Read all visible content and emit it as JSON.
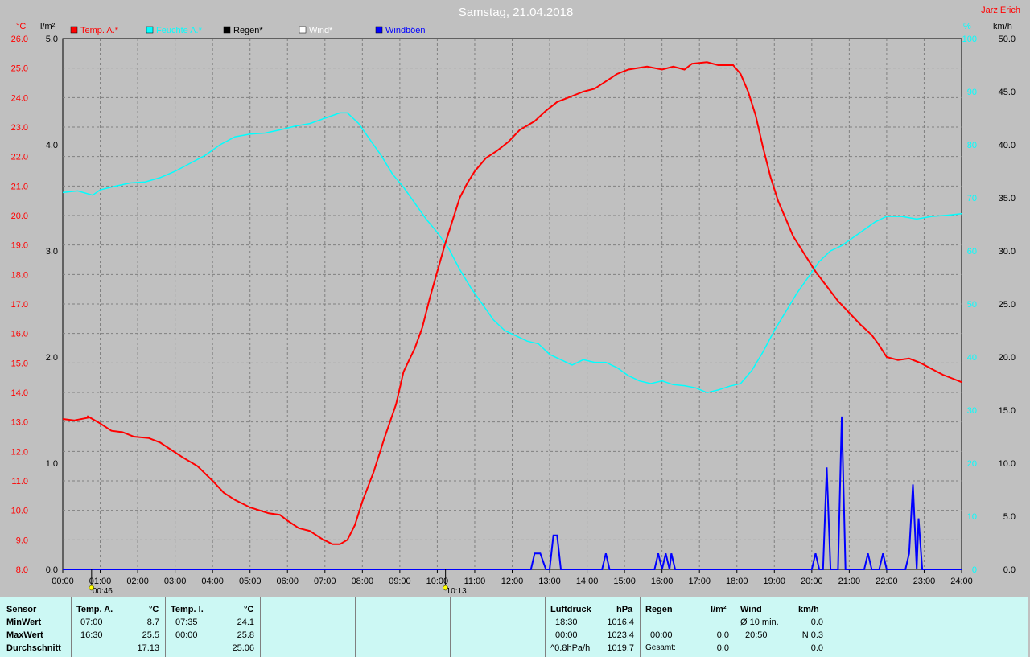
{
  "chart_data": {
    "type": "line",
    "title": "Samstag, 21.04.2018",
    "station": "Jarz Erich",
    "legend": [
      {
        "label": "Temp. A.*",
        "color": "#ff0000"
      },
      {
        "label": "Feuchte A.*",
        "color": "#00ffff"
      },
      {
        "label": "Regen*",
        "color": "#000000"
      },
      {
        "label": "Wind*",
        "color": "#ffffff"
      },
      {
        "label": "Windböen",
        "color": "#0000ff"
      }
    ],
    "axes": {
      "temp": {
        "unit": "°C",
        "min": 8.0,
        "max": 26.0,
        "step": 1.0
      },
      "rain": {
        "unit": "l/m²",
        "min": 0.0,
        "max": 5.0,
        "step": 1.0
      },
      "hum": {
        "unit": "%",
        "min": 0,
        "max": 100,
        "step": 10
      },
      "wind": {
        "unit": "km/h",
        "min": 0.0,
        "max": 50.0,
        "step": 5.0
      }
    },
    "x_ticks": [
      "00:00",
      "01:00",
      "02:00",
      "03:00",
      "04:00",
      "05:00",
      "06:00",
      "07:00",
      "08:00",
      "09:00",
      "10:00",
      "11:00",
      "12:00",
      "13:00",
      "14:00",
      "15:00",
      "16:00",
      "17:00",
      "18:00",
      "19:00",
      "20:00",
      "21:00",
      "22:00",
      "23:00",
      "24:00"
    ],
    "sun_marks": [
      {
        "hour": 0.77,
        "label": "00:46"
      },
      {
        "hour": 10.22,
        "label": "10:13"
      }
    ],
    "temp_series": [
      [
        0,
        13.1
      ],
      [
        0.3,
        13.05
      ],
      [
        0.7,
        13.15
      ],
      [
        0.65,
        13.2
      ],
      [
        1.0,
        12.95
      ],
      [
        1.3,
        12.7
      ],
      [
        1.6,
        12.65
      ],
      [
        1.9,
        12.5
      ],
      [
        2.3,
        12.45
      ],
      [
        2.6,
        12.3
      ],
      [
        2.9,
        12.05
      ],
      [
        3.2,
        11.8
      ],
      [
        3.6,
        11.5
      ],
      [
        4.0,
        11.0
      ],
      [
        4.3,
        10.6
      ],
      [
        4.6,
        10.35
      ],
      [
        5.0,
        10.1
      ],
      [
        5.5,
        9.9
      ],
      [
        5.8,
        9.85
      ],
      [
        6.0,
        9.65
      ],
      [
        6.3,
        9.4
      ],
      [
        6.6,
        9.3
      ],
      [
        6.9,
        9.05
      ],
      [
        7.2,
        8.85
      ],
      [
        7.4,
        8.85
      ],
      [
        7.6,
        9.0
      ],
      [
        7.8,
        9.5
      ],
      [
        8.0,
        10.3
      ],
      [
        8.3,
        11.3
      ],
      [
        8.6,
        12.5
      ],
      [
        8.9,
        13.6
      ],
      [
        9.1,
        14.7
      ],
      [
        9.4,
        15.5
      ],
      [
        9.6,
        16.2
      ],
      [
        9.8,
        17.2
      ],
      [
        10.0,
        18.1
      ],
      [
        10.2,
        19.0
      ],
      [
        10.4,
        19.8
      ],
      [
        10.6,
        20.6
      ],
      [
        10.8,
        21.1
      ],
      [
        11.0,
        21.5
      ],
      [
        11.3,
        21.95
      ],
      [
        11.6,
        22.2
      ],
      [
        11.9,
        22.5
      ],
      [
        12.2,
        22.9
      ],
      [
        12.6,
        23.2
      ],
      [
        12.9,
        23.55
      ],
      [
        13.2,
        23.85
      ],
      [
        13.6,
        24.05
      ],
      [
        13.9,
        24.2
      ],
      [
        14.2,
        24.3
      ],
      [
        14.5,
        24.55
      ],
      [
        14.8,
        24.8
      ],
      [
        15.1,
        24.95
      ],
      [
        15.6,
        25.05
      ],
      [
        16.0,
        24.95
      ],
      [
        16.3,
        25.05
      ],
      [
        16.6,
        24.95
      ],
      [
        16.8,
        25.15
      ],
      [
        17.2,
        25.2
      ],
      [
        17.5,
        25.1
      ],
      [
        17.9,
        25.1
      ],
      [
        18.1,
        24.8
      ],
      [
        18.3,
        24.2
      ],
      [
        18.5,
        23.4
      ],
      [
        18.7,
        22.3
      ],
      [
        18.9,
        21.3
      ],
      [
        19.1,
        20.5
      ],
      [
        19.3,
        19.9
      ],
      [
        19.5,
        19.3
      ],
      [
        19.8,
        18.7
      ],
      [
        20.1,
        18.1
      ],
      [
        20.4,
        17.6
      ],
      [
        20.7,
        17.1
      ],
      [
        21.0,
        16.7
      ],
      [
        21.3,
        16.3
      ],
      [
        21.6,
        15.95
      ],
      [
        21.8,
        15.6
      ],
      [
        22.0,
        15.2
      ],
      [
        22.3,
        15.1
      ],
      [
        22.6,
        15.15
      ],
      [
        22.9,
        15.0
      ],
      [
        23.2,
        14.8
      ],
      [
        23.5,
        14.6
      ],
      [
        23.8,
        14.45
      ],
      [
        24.0,
        14.35
      ]
    ],
    "humidity_series": [
      [
        0,
        71.0
      ],
      [
        0.4,
        71.3
      ],
      [
        0.8,
        70.5
      ],
      [
        1.0,
        71.5
      ],
      [
        1.4,
        72.2
      ],
      [
        1.8,
        72.8
      ],
      [
        2.2,
        73.0
      ],
      [
        2.6,
        73.8
      ],
      [
        3.0,
        75.0
      ],
      [
        3.4,
        76.5
      ],
      [
        3.8,
        78.0
      ],
      [
        4.2,
        80.0
      ],
      [
        4.6,
        81.5
      ],
      [
        5.0,
        82.0
      ],
      [
        5.4,
        82.2
      ],
      [
        5.8,
        82.8
      ],
      [
        6.2,
        83.5
      ],
      [
        6.6,
        84.0
      ],
      [
        7.0,
        85.0
      ],
      [
        7.4,
        86.0
      ],
      [
        7.6,
        86.0
      ],
      [
        7.9,
        84.0
      ],
      [
        8.2,
        81.0
      ],
      [
        8.5,
        78.0
      ],
      [
        8.8,
        74.5
      ],
      [
        9.1,
        72.0
      ],
      [
        9.4,
        69.0
      ],
      [
        9.7,
        66.0
      ],
      [
        10.0,
        63.5
      ],
      [
        10.3,
        60.5
      ],
      [
        10.6,
        56.5
      ],
      [
        10.9,
        53.0
      ],
      [
        11.2,
        50.0
      ],
      [
        11.5,
        47.0
      ],
      [
        11.8,
        45.0
      ],
      [
        12.1,
        44.0
      ],
      [
        12.4,
        43.0
      ],
      [
        12.7,
        42.5
      ],
      [
        13.0,
        40.5
      ],
      [
        13.3,
        39.5
      ],
      [
        13.6,
        38.5
      ],
      [
        13.9,
        39.5
      ],
      [
        14.2,
        39.0
      ],
      [
        14.5,
        39.0
      ],
      [
        14.8,
        38.0
      ],
      [
        15.1,
        36.5
      ],
      [
        15.4,
        35.5
      ],
      [
        15.7,
        35.0
      ],
      [
        16.0,
        35.5
      ],
      [
        16.3,
        34.8
      ],
      [
        16.6,
        34.6
      ],
      [
        16.9,
        34.2
      ],
      [
        17.2,
        33.3
      ],
      [
        17.5,
        33.8
      ],
      [
        17.8,
        34.5
      ],
      [
        18.1,
        35.0
      ],
      [
        18.4,
        37.5
      ],
      [
        18.7,
        41.0
      ],
      [
        19.0,
        45.0
      ],
      [
        19.3,
        48.5
      ],
      [
        19.6,
        52.0
      ],
      [
        19.9,
        55.0
      ],
      [
        20.2,
        58.0
      ],
      [
        20.5,
        60.0
      ],
      [
        20.8,
        61.0
      ],
      [
        21.1,
        62.5
      ],
      [
        21.4,
        64.0
      ],
      [
        21.7,
        65.5
      ],
      [
        22.0,
        66.5
      ],
      [
        22.4,
        66.5
      ],
      [
        22.8,
        66.0
      ],
      [
        23.2,
        66.5
      ],
      [
        23.6,
        66.7
      ],
      [
        24.0,
        67.0
      ]
    ],
    "gust_series": [
      [
        0,
        0
      ],
      [
        12.5,
        0
      ],
      [
        12.6,
        1.5
      ],
      [
        12.75,
        1.5
      ],
      [
        12.9,
        0
      ],
      [
        13.0,
        0
      ],
      [
        13.1,
        3.2
      ],
      [
        13.2,
        3.2
      ],
      [
        13.3,
        0
      ],
      [
        14.4,
        0
      ],
      [
        14.5,
        1.5
      ],
      [
        14.6,
        0
      ],
      [
        15.8,
        0
      ],
      [
        15.9,
        1.5
      ],
      [
        16.0,
        0
      ],
      [
        16.1,
        1.5
      ],
      [
        16.2,
        0
      ],
      [
        16.25,
        1.5
      ],
      [
        16.35,
        0
      ],
      [
        20.0,
        0
      ],
      [
        20.1,
        1.5
      ],
      [
        20.2,
        0
      ],
      [
        20.3,
        0
      ],
      [
        20.4,
        9.6
      ],
      [
        20.5,
        0
      ],
      [
        20.7,
        0
      ],
      [
        20.8,
        14.4
      ],
      [
        20.9,
        0
      ],
      [
        21.4,
        0
      ],
      [
        21.5,
        1.5
      ],
      [
        21.6,
        0
      ],
      [
        21.8,
        0
      ],
      [
        21.9,
        1.5
      ],
      [
        22.0,
        0
      ],
      [
        22.5,
        0
      ],
      [
        22.6,
        1.5
      ],
      [
        22.7,
        8.0
      ],
      [
        22.8,
        0
      ],
      [
        22.85,
        4.8
      ],
      [
        22.95,
        0
      ],
      [
        24,
        0
      ]
    ]
  },
  "summary": {
    "sensor_header": "Sensor",
    "row_labels": [
      "MinWert",
      "MaxWert",
      "Durchschnitt"
    ],
    "temp_a": {
      "title": "Temp. A.",
      "unit": "°C",
      "min_time": "07:00",
      "min": "8.7",
      "max_time": "16:30",
      "max": "25.5",
      "avg": "17.13"
    },
    "temp_i": {
      "title": "Temp. I.",
      "unit": "°C",
      "min_time": "07:35",
      "min": "24.1",
      "max_time": "00:00",
      "max": "25.8",
      "avg": "25.06"
    },
    "pressure": {
      "title": "Luftdruck",
      "unit": "hPa",
      "min_time": "18:30",
      "min": "1016.4",
      "max_time": "00:00",
      "max": "1023.4",
      "avg_label": "^0.8hPa/h",
      "avg": "1019.7"
    },
    "rain": {
      "title": "Regen",
      "unit": "l/m²",
      "max_time": "00:00",
      "max": "0.0",
      "total_label": "Gesamt:",
      "total": "0.0"
    },
    "wind": {
      "title": "Wind",
      "unit": "km/h",
      "min_label": "Ø 10 min.",
      "min": "0.0",
      "max_time": "20:50",
      "max": "N 0.3",
      "avg": "0.0"
    }
  }
}
